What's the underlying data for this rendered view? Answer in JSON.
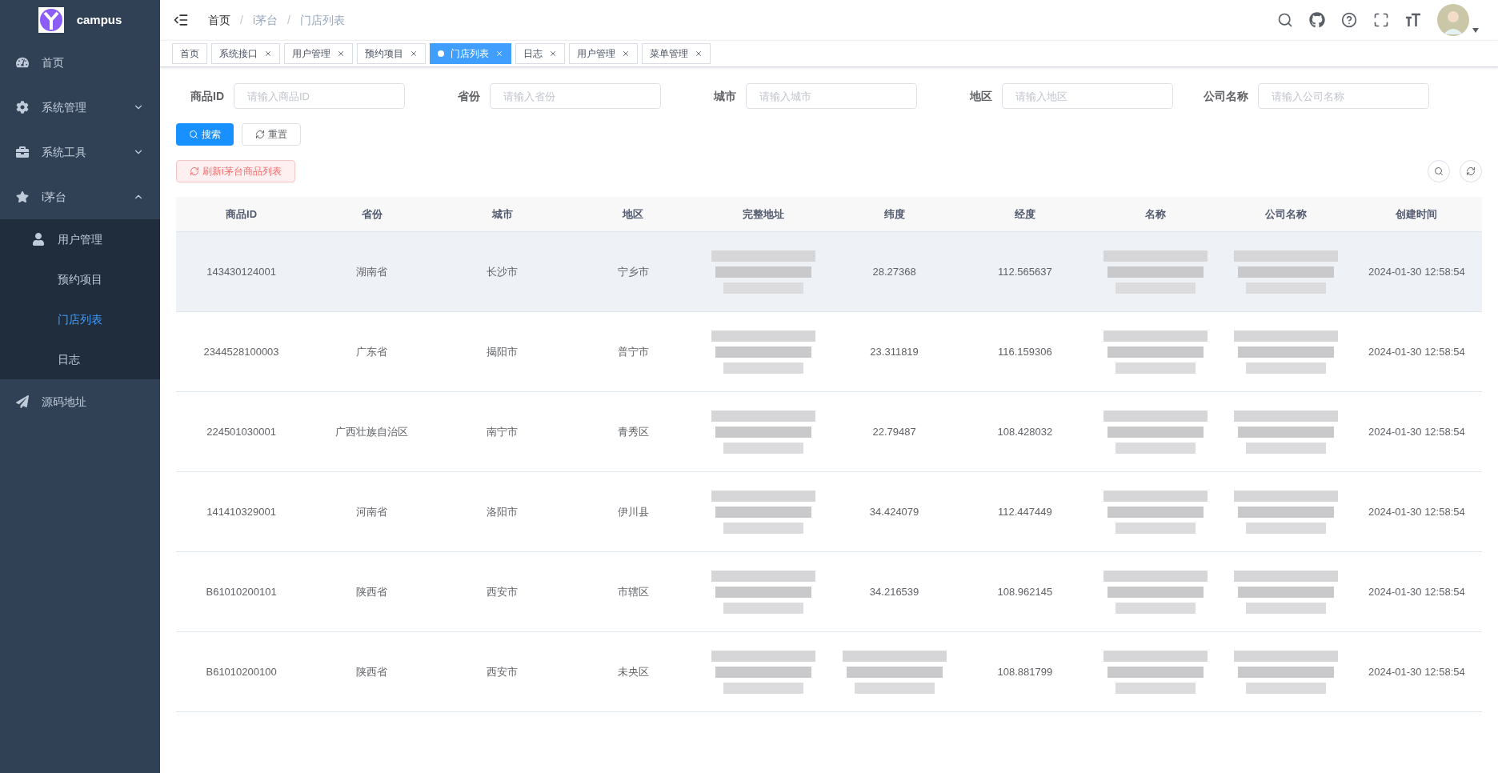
{
  "sidebar": {
    "brand": "campus",
    "items": [
      {
        "label": "首页"
      },
      {
        "label": "系统管理",
        "expanded": false
      },
      {
        "label": "系统工具",
        "expanded": false
      },
      {
        "label": "i茅台",
        "expanded": true,
        "children": [
          {
            "label": "用户管理",
            "selected": false
          },
          {
            "label": "预约项目",
            "selected": false
          },
          {
            "label": "门店列表",
            "selected": true
          },
          {
            "label": "日志",
            "selected": false
          }
        ]
      },
      {
        "label": "源码地址"
      }
    ]
  },
  "breadcrumb": [
    {
      "label": "首页"
    },
    {
      "separator": "/",
      "label": "i茅台"
    },
    {
      "separator": "/",
      "label": "门店列表"
    }
  ],
  "tabs": [
    {
      "label": "首页",
      "selected": false,
      "closable": false
    },
    {
      "label": "系统接口",
      "selected": false,
      "closable": true
    },
    {
      "label": "用户管理",
      "selected": false,
      "closable": true
    },
    {
      "label": "预约项目",
      "selected": false,
      "closable": true
    },
    {
      "label": "门店列表",
      "selected": true,
      "closable": true
    },
    {
      "label": "日志",
      "selected": false,
      "closable": true
    },
    {
      "label": "用户管理",
      "selected": false,
      "closable": true
    },
    {
      "label": "菜单管理",
      "selected": false,
      "closable": true
    }
  ],
  "filters": [
    {
      "label": "商品ID",
      "placeholder": "请输入商品ID"
    },
    {
      "label": "省份",
      "placeholder": "请输入省份"
    },
    {
      "label": "城市",
      "placeholder": "请输入城市"
    },
    {
      "label": "地区",
      "placeholder": "请输入地区"
    },
    {
      "label": "公司名称",
      "placeholder": "请输入公司名称"
    }
  ],
  "search_button": "搜索",
  "reset_button": "重置",
  "refresh_button": "刷新i茅台商品列表",
  "table": {
    "columns": [
      "商品ID",
      "省份",
      "城市",
      "地区",
      "完整地址",
      "纬度",
      "经度",
      "名称",
      "公司名称",
      "创建时间"
    ],
    "rows": [
      {
        "selected": true,
        "cells": [
          {
            "kind": "text",
            "text": "143430124001"
          },
          {
            "kind": "text",
            "text": "湖南省"
          },
          {
            "kind": "text",
            "text": "长沙市"
          },
          {
            "kind": "text",
            "text": "宁乡市"
          },
          {
            "kind": "blurred"
          },
          {
            "kind": "text",
            "text": "28.27368"
          },
          {
            "kind": "text",
            "text": "112.565637"
          },
          {
            "kind": "blurred"
          },
          {
            "kind": "blurred"
          },
          {
            "kind": "text",
            "text": "2024-01-30 12:58:54"
          }
        ]
      },
      {
        "selected": false,
        "cells": [
          {
            "kind": "text",
            "text": "2344528100003"
          },
          {
            "kind": "text",
            "text": "广东省"
          },
          {
            "kind": "text",
            "text": "揭阳市"
          },
          {
            "kind": "text",
            "text": "普宁市"
          },
          {
            "kind": "blurred"
          },
          {
            "kind": "text",
            "text": "23.311819"
          },
          {
            "kind": "text",
            "text": "116.159306"
          },
          {
            "kind": "blurred"
          },
          {
            "kind": "blurred"
          },
          {
            "kind": "text",
            "text": "2024-01-30 12:58:54"
          }
        ]
      },
      {
        "selected": false,
        "cells": [
          {
            "kind": "text",
            "text": "224501030001"
          },
          {
            "kind": "text",
            "text": "广西壮族自治区"
          },
          {
            "kind": "text",
            "text": "南宁市"
          },
          {
            "kind": "text",
            "text": "青秀区"
          },
          {
            "kind": "blurred"
          },
          {
            "kind": "text",
            "text": "22.79487"
          },
          {
            "kind": "text",
            "text": "108.428032"
          },
          {
            "kind": "blurred"
          },
          {
            "kind": "blurred"
          },
          {
            "kind": "text",
            "text": "2024-01-30 12:58:54"
          }
        ]
      },
      {
        "selected": false,
        "cells": [
          {
            "kind": "text",
            "text": "141410329001"
          },
          {
            "kind": "text",
            "text": "河南省"
          },
          {
            "kind": "text",
            "text": "洛阳市"
          },
          {
            "kind": "text",
            "text": "伊川县"
          },
          {
            "kind": "blurred"
          },
          {
            "kind": "text",
            "text": "34.424079"
          },
          {
            "kind": "text",
            "text": "112.447449"
          },
          {
            "kind": "blurred"
          },
          {
            "kind": "blurred"
          },
          {
            "kind": "text",
            "text": "2024-01-30 12:58:54"
          }
        ]
      },
      {
        "selected": false,
        "cells": [
          {
            "kind": "text",
            "text": "B61010200101"
          },
          {
            "kind": "text",
            "text": "陕西省"
          },
          {
            "kind": "text",
            "text": "西安市"
          },
          {
            "kind": "text",
            "text": "市辖区"
          },
          {
            "kind": "blurred"
          },
          {
            "kind": "text",
            "text": "34.216539"
          },
          {
            "kind": "text",
            "text": "108.962145"
          },
          {
            "kind": "blurred"
          },
          {
            "kind": "blurred"
          },
          {
            "kind": "text",
            "text": "2024-01-30 12:58:54"
          }
        ]
      },
      {
        "selected": false,
        "cells": [
          {
            "kind": "text",
            "text": "B61010200100"
          },
          {
            "kind": "text",
            "text": "陕西省"
          },
          {
            "kind": "text",
            "text": "西安市"
          },
          {
            "kind": "text",
            "text": "未央区"
          },
          {
            "kind": "blurred"
          },
          {
            "kind": "blurred"
          },
          {
            "kind": "text",
            "text": "108.881799"
          },
          {
            "kind": "blurred"
          },
          {
            "kind": "blurred"
          },
          {
            "kind": "text",
            "text": "2024-01-30 12:58:54"
          }
        ]
      }
    ]
  }
}
